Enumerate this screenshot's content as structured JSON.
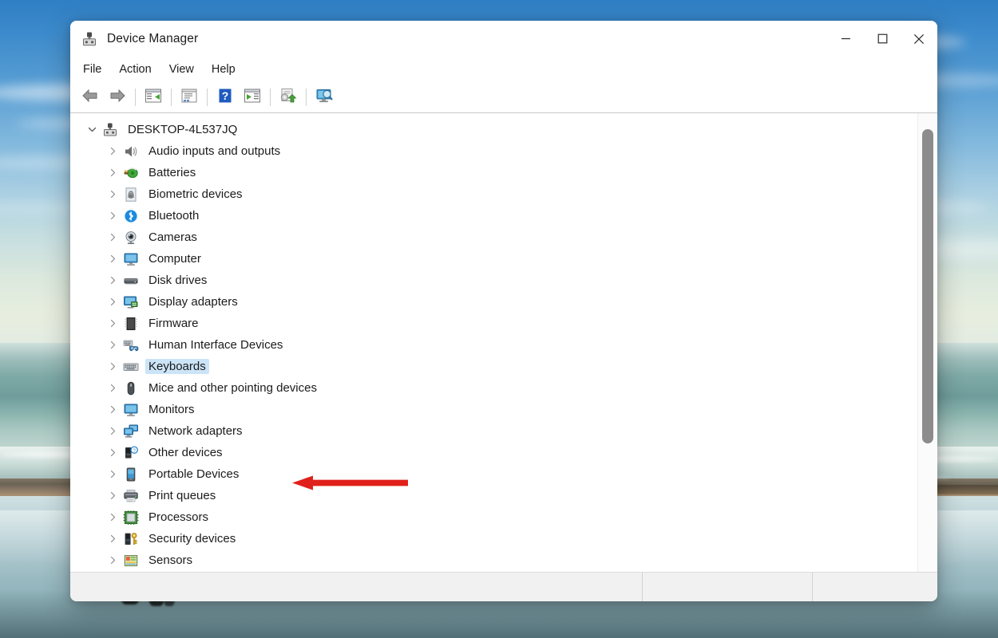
{
  "window": {
    "title": "Device Manager",
    "icon": "device-manager-icon",
    "controls": {
      "minimize": "Minimize",
      "maximize": "Maximize",
      "close": "Close"
    }
  },
  "menubar": {
    "items": [
      {
        "label": "File",
        "name": "menu-file"
      },
      {
        "label": "Action",
        "name": "menu-action"
      },
      {
        "label": "View",
        "name": "menu-view"
      },
      {
        "label": "Help",
        "name": "menu-help"
      }
    ]
  },
  "toolbar": {
    "buttons": [
      {
        "name": "back-button",
        "icon": "back-arrow-icon",
        "title": "Back"
      },
      {
        "name": "forward-button",
        "icon": "forward-arrow-icon",
        "title": "Forward"
      },
      {
        "name": "show-hide-console-tree-button",
        "icon": "console-tree-icon",
        "title": "Show/Hide Console Tree"
      },
      {
        "name": "properties-button",
        "icon": "properties-icon",
        "title": "Properties"
      },
      {
        "name": "help-button",
        "icon": "help-question-icon",
        "title": "Help"
      },
      {
        "name": "update-driver-button",
        "icon": "update-driver-icon",
        "title": "Update Driver"
      },
      {
        "name": "scan-hardware-changes-button",
        "icon": "scan-hardware-icon",
        "title": "Scan for hardware changes"
      },
      {
        "name": "add-legacy-hardware-button",
        "icon": "add-hardware-icon",
        "title": "Add legacy hardware"
      }
    ]
  },
  "tree": {
    "root": {
      "label": "DESKTOP-4L537JQ",
      "icon": "computer-root-icon",
      "expanded": true,
      "twisty": "chevron-down"
    },
    "nodes": [
      {
        "label": "Audio inputs and outputs",
        "icon": "speaker-icon",
        "twisty": "chevron-right",
        "selected": false
      },
      {
        "label": "Batteries",
        "icon": "battery-icon",
        "twisty": "chevron-right",
        "selected": false
      },
      {
        "label": "Biometric devices",
        "icon": "fingerprint-icon",
        "twisty": "chevron-right",
        "selected": false
      },
      {
        "label": "Bluetooth",
        "icon": "bluetooth-icon",
        "twisty": "chevron-right",
        "selected": false
      },
      {
        "label": "Cameras",
        "icon": "camera-icon",
        "twisty": "chevron-right",
        "selected": false
      },
      {
        "label": "Computer",
        "icon": "monitor-icon",
        "twisty": "chevron-right",
        "selected": false
      },
      {
        "label": "Disk drives",
        "icon": "disk-drive-icon",
        "twisty": "chevron-right",
        "selected": false
      },
      {
        "label": "Display adapters",
        "icon": "display-adapter-icon",
        "twisty": "chevron-right",
        "selected": false
      },
      {
        "label": "Firmware",
        "icon": "firmware-chip-icon",
        "twisty": "chevron-right",
        "selected": false
      },
      {
        "label": "Human Interface Devices",
        "icon": "hid-icon",
        "twisty": "chevron-right",
        "selected": false
      },
      {
        "label": "Keyboards",
        "icon": "keyboard-icon",
        "twisty": "chevron-right",
        "selected": true
      },
      {
        "label": "Mice and other pointing devices",
        "icon": "mouse-icon",
        "twisty": "chevron-right",
        "selected": false
      },
      {
        "label": "Monitors",
        "icon": "monitor-icon",
        "twisty": "chevron-right",
        "selected": false
      },
      {
        "label": "Network adapters",
        "icon": "network-adapter-icon",
        "twisty": "chevron-right",
        "selected": false
      },
      {
        "label": "Other devices",
        "icon": "other-devices-icon",
        "twisty": "chevron-right",
        "selected": false
      },
      {
        "label": "Portable Devices",
        "icon": "portable-device-icon",
        "twisty": "chevron-right",
        "selected": false
      },
      {
        "label": "Print queues",
        "icon": "printer-icon",
        "twisty": "chevron-right",
        "selected": false
      },
      {
        "label": "Processors",
        "icon": "processor-icon",
        "twisty": "chevron-right",
        "selected": false
      },
      {
        "label": "Security devices",
        "icon": "security-key-icon",
        "twisty": "chevron-right",
        "selected": false
      },
      {
        "label": "Sensors",
        "icon": "sensor-icon",
        "twisty": "chevron-right",
        "selected": false
      }
    ]
  },
  "statusbar": {
    "main": "",
    "segment2": "",
    "segment3": ""
  },
  "annotation": {
    "type": "arrow",
    "direction": "left",
    "color": "#e0201b",
    "points_at": "Keyboards"
  },
  "scrollbar": {
    "orientation": "vertical",
    "thumb_top_pct": 4,
    "thumb_height_pct": 70
  },
  "colors": {
    "selection": "#cce4f7",
    "annotation_red": "#e0201b",
    "window_bg": "#ffffff",
    "statusbar_bg": "#f1f1f1"
  }
}
